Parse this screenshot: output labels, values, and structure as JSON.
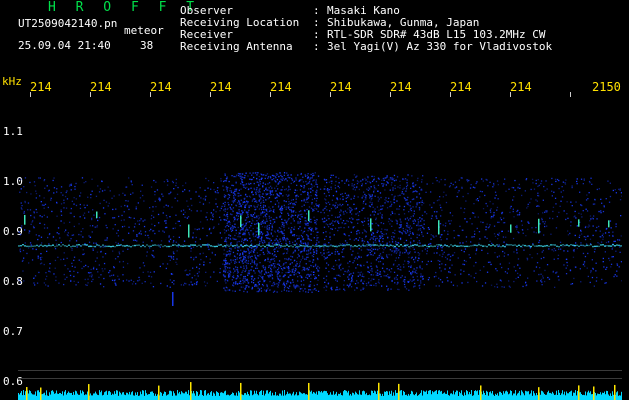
{
  "header": {
    "title": "H R O F F T",
    "filename": "UT2509042140.pn",
    "file_suffix": "meteor",
    "date_time": "25.09.04 21:40",
    "count": "38",
    "fields": [
      {
        "key": "Observer",
        "value": "Masaki Kano"
      },
      {
        "key": "Receiving Location",
        "value": "Shibukawa, Gunma, Japan"
      },
      {
        "key": "Receiver",
        "value": "RTL-SDR SDR# 43dB L15 103.2MHz CW"
      },
      {
        "key": "Receiving Antenna",
        "value": "3el Yagi(V) Az 330 for Vladivostok"
      }
    ]
  },
  "spectrogram": {
    "y_unit": "kHz",
    "y_ticks": [
      "1.1",
      "1.0",
      "0.9",
      "0.8",
      "0.7",
      "0.6"
    ],
    "x_ticks": [
      "214",
      "214",
      "214",
      "214",
      "214",
      "214",
      "214",
      "214",
      "214",
      "2150"
    ],
    "colors": {
      "background": "#000000",
      "noise": "#1a3cff",
      "meteor": "#40e8ff",
      "axis_text": "#ffe100",
      "signal_bar": "#00d8ff",
      "spike": "#ffe600"
    }
  }
}
